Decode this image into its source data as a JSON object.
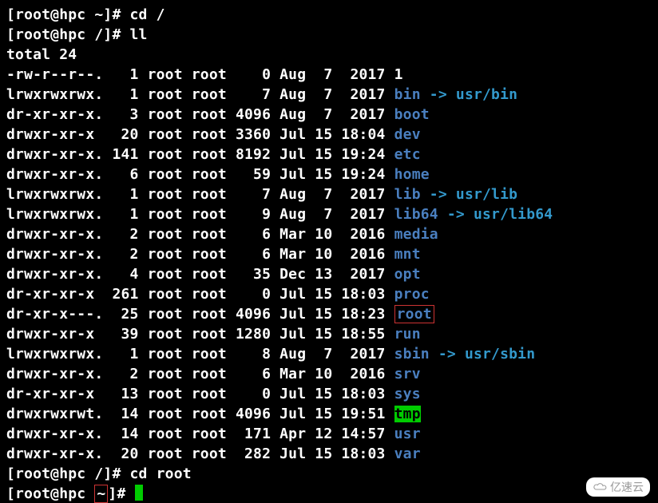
{
  "prompts": {
    "p1": "[root@hpc ~]# ",
    "cmd1": "cd /",
    "p2": "[root@hpc /]# ",
    "cmd2": "ll",
    "p3": "[root@hpc /]# ",
    "cmd3": "cd root",
    "p4_left": "[root@hpc ",
    "p4_tilde": "~",
    "p4_right": "]# "
  },
  "total_line": "total 24",
  "rows": [
    {
      "perm": "-rw-r--r--.",
      "links": "1",
      "user": "root",
      "group": "root",
      "size": "0",
      "month": "Aug",
      "day": "7",
      "timeyear": "2017",
      "name": "1",
      "type": "plain"
    },
    {
      "perm": "lrwxrwxrwx.",
      "links": "1",
      "user": "root",
      "group": "root",
      "size": "7",
      "month": "Aug",
      "day": "7",
      "timeyear": "2017",
      "name": "bin",
      "type": "link",
      "arrow": " -> ",
      "target": "usr/bin"
    },
    {
      "perm": "dr-xr-xr-x.",
      "links": "3",
      "user": "root",
      "group": "root",
      "size": "4096",
      "month": "Aug",
      "day": "7",
      "timeyear": "2017",
      "name": "boot",
      "type": "dir"
    },
    {
      "perm": "drwxr-xr-x",
      "links": "20",
      "user": "root",
      "group": "root",
      "size": "3360",
      "month": "Jul",
      "day": "15",
      "timeyear": "18:04",
      "name": "dev",
      "type": "dir"
    },
    {
      "perm": "drwxr-xr-x.",
      "links": "141",
      "user": "root",
      "group": "root",
      "size": "8192",
      "month": "Jul",
      "day": "15",
      "timeyear": "19:24",
      "name": "etc",
      "type": "dir"
    },
    {
      "perm": "drwxr-xr-x.",
      "links": "6",
      "user": "root",
      "group": "root",
      "size": "59",
      "month": "Jul",
      "day": "15",
      "timeyear": "19:24",
      "name": "home",
      "type": "dir"
    },
    {
      "perm": "lrwxrwxrwx.",
      "links": "1",
      "user": "root",
      "group": "root",
      "size": "7",
      "month": "Aug",
      "day": "7",
      "timeyear": "2017",
      "name": "lib",
      "type": "link",
      "arrow": " -> ",
      "target": "usr/lib"
    },
    {
      "perm": "lrwxrwxrwx.",
      "links": "1",
      "user": "root",
      "group": "root",
      "size": "9",
      "month": "Aug",
      "day": "7",
      "timeyear": "2017",
      "name": "lib64",
      "type": "link",
      "arrow": " -> ",
      "target": "usr/lib64"
    },
    {
      "perm": "drwxr-xr-x.",
      "links": "2",
      "user": "root",
      "group": "root",
      "size": "6",
      "month": "Mar",
      "day": "10",
      "timeyear": "2016",
      "name": "media",
      "type": "dir"
    },
    {
      "perm": "drwxr-xr-x.",
      "links": "2",
      "user": "root",
      "group": "root",
      "size": "6",
      "month": "Mar",
      "day": "10",
      "timeyear": "2016",
      "name": "mnt",
      "type": "dir"
    },
    {
      "perm": "drwxr-xr-x.",
      "links": "4",
      "user": "root",
      "group": "root",
      "size": "35",
      "month": "Dec",
      "day": "13",
      "timeyear": "2017",
      "name": "opt",
      "type": "dir"
    },
    {
      "perm": "dr-xr-xr-x",
      "links": "261",
      "user": "root",
      "group": "root",
      "size": "0",
      "month": "Jul",
      "day": "15",
      "timeyear": "18:03",
      "name": "proc",
      "type": "dir"
    },
    {
      "perm": "dr-xr-x---.",
      "links": "25",
      "user": "root",
      "group": "root",
      "size": "4096",
      "month": "Jul",
      "day": "15",
      "timeyear": "18:23",
      "name": "root",
      "type": "boxed"
    },
    {
      "perm": "drwxr-xr-x",
      "links": "39",
      "user": "root",
      "group": "root",
      "size": "1280",
      "month": "Jul",
      "day": "15",
      "timeyear": "18:55",
      "name": "run",
      "type": "dir"
    },
    {
      "perm": "lrwxrwxrwx.",
      "links": "1",
      "user": "root",
      "group": "root",
      "size": "8",
      "month": "Aug",
      "day": "7",
      "timeyear": "2017",
      "name": "sbin",
      "type": "link",
      "arrow": " -> ",
      "target": "usr/sbin"
    },
    {
      "perm": "drwxr-xr-x.",
      "links": "2",
      "user": "root",
      "group": "root",
      "size": "6",
      "month": "Mar",
      "day": "10",
      "timeyear": "2016",
      "name": "srv",
      "type": "dir"
    },
    {
      "perm": "dr-xr-xr-x",
      "links": "13",
      "user": "root",
      "group": "root",
      "size": "0",
      "month": "Jul",
      "day": "15",
      "timeyear": "18:03",
      "name": "sys",
      "type": "dir"
    },
    {
      "perm": "drwxrwxrwt.",
      "links": "14",
      "user": "root",
      "group": "root",
      "size": "4096",
      "month": "Jul",
      "day": "15",
      "timeyear": "19:51",
      "name": "tmp",
      "type": "tmp"
    },
    {
      "perm": "drwxr-xr-x.",
      "links": "14",
      "user": "root",
      "group": "root",
      "size": "171",
      "month": "Apr",
      "day": "12",
      "timeyear": "14:57",
      "name": "usr",
      "type": "dir"
    },
    {
      "perm": "drwxr-xr-x.",
      "links": "20",
      "user": "root",
      "group": "root",
      "size": "282",
      "month": "Jul",
      "day": "15",
      "timeyear": "18:03",
      "name": "var",
      "type": "dir"
    }
  ],
  "watermark": "亿速云"
}
